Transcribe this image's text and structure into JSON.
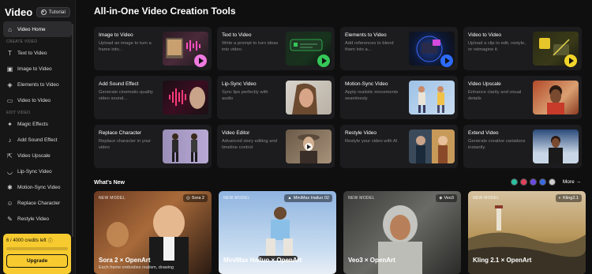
{
  "app": {
    "title": "Video",
    "tutorial": "Tutorial"
  },
  "sidebar": {
    "home": "Video Home",
    "create_label": "CREATE VIDEO",
    "create_items": [
      "Text to Video",
      "Image to Video",
      "Elements to Video",
      "Video to Video"
    ],
    "edit_label": "EDIT VIDEO",
    "edit_items": [
      "Magic Effects",
      "Add Sound Effect",
      "Video Upscale",
      "Lip-Sync Video",
      "Motion-Sync Video",
      "Replace Character",
      "Restyle Video"
    ],
    "credits": "6 / 4000 credits left",
    "upgrade": "Upgrade"
  },
  "main": {
    "title": "All-in-One Video Creation Tools",
    "tools": [
      {
        "name": "Image to Video",
        "desc": "Upload an image to turn a frame into...",
        "play": "#f07ae0"
      },
      {
        "name": "Text to Video",
        "desc": "Write a prompt to turn ideas into video.",
        "play": "#35c759"
      },
      {
        "name": "Elements to Video",
        "desc": "Add references to blend them into a...",
        "play": "#2d6bff"
      },
      {
        "name": "Video to Video",
        "desc": "Upload a clip to edit, restyle, or reimagine it.",
        "play": "#f2d52a"
      },
      {
        "name": "Add Sound Effect",
        "desc": "Generate cinematic-quality video sound...",
        "play": ""
      },
      {
        "name": "Lip-Sync Video",
        "desc": "Sync lips perfectly with audio",
        "play": ""
      },
      {
        "name": "Motion-Sync Video",
        "desc": "Apply realistic movements seamlessly",
        "play": ""
      },
      {
        "name": "Video Upscale",
        "desc": "Enhance clarity and visual details",
        "play": ""
      },
      {
        "name": "Replace Character",
        "desc": "Replace character in your video",
        "play": ""
      },
      {
        "name": "Video Editor",
        "desc": "Advanced story editing and timeline control",
        "play": ""
      },
      {
        "name": "Restyle Video",
        "desc": "Restyle your video with AI",
        "play": ""
      },
      {
        "name": "Extend Video",
        "desc": "Generate creative variations instantly.",
        "play": ""
      }
    ],
    "whats_new": "What's New",
    "more": "More",
    "cards": [
      {
        "badge": "NEW MODEL",
        "model": "Sora 2",
        "title": "Sora 2 × OpenArt",
        "sub": "Each frame embodies realism, drawing"
      },
      {
        "badge": "NEW MODEL",
        "model": "MiniMax Hailuo 02",
        "title": "MiniMax Hailuo × OpenArt",
        "sub": ""
      },
      {
        "badge": "NEW MODEL",
        "model": "Veo3",
        "title": "Veo3 × OpenArt",
        "sub": ""
      },
      {
        "badge": "NEW MODEL",
        "model": "Kling2.1",
        "title": "Kling 2.1 × OpenArt",
        "sub": ""
      }
    ]
  }
}
